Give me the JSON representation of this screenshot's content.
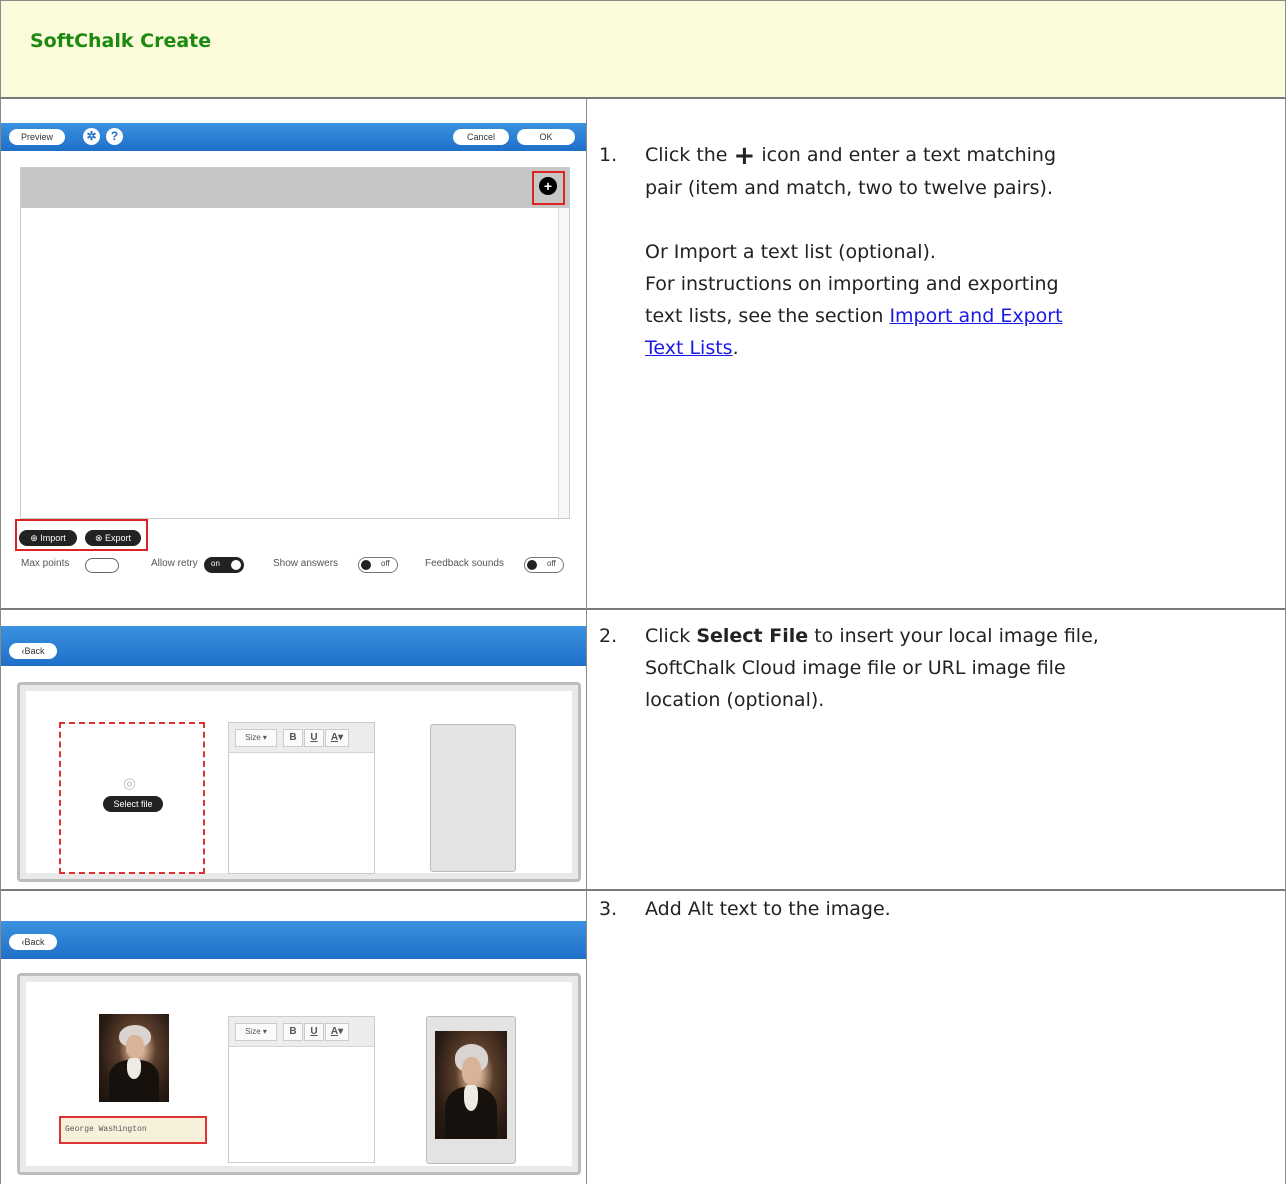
{
  "header": {
    "title": "SoftChalk Create"
  },
  "rows": [
    {
      "step_number": "1.",
      "screenshot": {
        "preview_label": "Preview",
        "settings_icon": "gear-icon",
        "help_label": "?",
        "cancel_label": "Cancel",
        "ok_label": "OK",
        "add_label": "+",
        "import_label": "Import",
        "export_label": "Export",
        "max_points_label": "Max points",
        "allow_retry_label": "Allow retry",
        "allow_retry_state": "on",
        "show_answers_label": "Show answers",
        "show_answers_state": "off",
        "feedback_sounds_label": "Feedback sounds",
        "feedback_sounds_state": "off"
      },
      "text_line1_pre": "Click the",
      "text_line1_icon": "+",
      "text_line1_post": "icon and enter a text matching",
      "text_line2": "pair (item and match, two to twelve pairs).",
      "text_line3": "Or Import a text list (optional).",
      "text_line4": "For instructions on importing and exporting",
      "text_line5_pre": "text lists, see the section",
      "link_line1": "Import and Export",
      "link_line2": "Text Lists",
      "text_line6_post": "."
    },
    {
      "step_number": "2.",
      "screenshot": {
        "back_label": "Back",
        "select_file_label": "Select file",
        "size_label": "Size",
        "bold_label": "B",
        "underline_label": "U",
        "color_label": "A"
      },
      "text_pre": "Click",
      "text_bold": "Select File",
      "text_line1_post": "to insert your local image file,",
      "text_line2": "SoftChalk Cloud image file or URL image file",
      "text_line3": "location (optional)."
    },
    {
      "step_number": "3.",
      "screenshot": {
        "back_label": "Back",
        "size_label": "Size",
        "bold_label": "B",
        "underline_label": "U",
        "color_label": "A",
        "alt_text_value": "George Washington"
      },
      "text": "Add Alt text to the image."
    }
  ]
}
